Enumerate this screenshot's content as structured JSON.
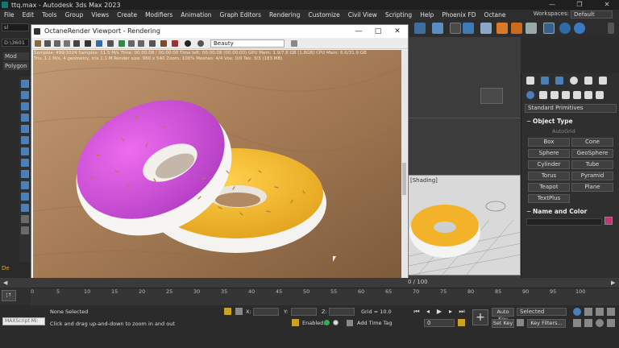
{
  "window": {
    "title": "ttq.max - Autodesk 3ds Max 2023",
    "minimize": "—",
    "maximize": "❐",
    "close": "✕"
  },
  "menu": {
    "items": [
      "File",
      "Edit",
      "Tools",
      "Group",
      "Views",
      "Create",
      "Modifiers",
      "Animation",
      "Graph Editors",
      "Rendering",
      "Customize",
      "Civil View",
      "Scripting",
      "Help",
      "Phoenix FD",
      "Octane"
    ],
    "workspaces_label": "Workspaces:",
    "workspaces_value": "Default"
  },
  "left_panel": {
    "field1": "sl",
    "field2": "D:\\3601",
    "tab1": "Mod",
    "tab2": "Polygon",
    "bottom_label": "De"
  },
  "octane": {
    "title": "OctaneRender Viewport - Rendering",
    "kernel": "Beauty",
    "stats_line1": "Samples: 499/1024   Samples: 11.5 M/s   Time: 00:00:08 / 00:00:00   Time left: 00:00:08 (00:00:00)   GPU Mem: 1.9/7.8 GB (1.8GB)   CPU Mem: 6.6/31.9 GB",
    "stats_line2": "Tris: 1.1 M/s, 4 geometry, tris 1.1 M   Render size: 960 x 540   Zoom: 100%   Meshes: 4/4   Vox: 0/0   Tex: 3/3 (183 MB)"
  },
  "small_viewport": {
    "label": "[Shading]"
  },
  "command_panel": {
    "dropdown": "Standard Primitives",
    "object_type_title": "Object Type",
    "autogrid": "AutoGrid",
    "buttons": [
      "Box",
      "Cone",
      "Sphere",
      "GeoSphere",
      "Cylinder",
      "Tube",
      "Torus",
      "Pyramid",
      "Teapot",
      "Plane",
      "TextPlus"
    ],
    "name_color_title": "Name and Color",
    "swatch_color": "#c8337a"
  },
  "timeline": {
    "frame_counter": "0 / 100",
    "ticks": [
      "0",
      "5",
      "10",
      "15",
      "20",
      "25",
      "30",
      "35",
      "40",
      "45",
      "50",
      "55",
      "60",
      "65",
      "70",
      "75",
      "80",
      "85",
      "90",
      "95",
      "100"
    ]
  },
  "statusbar": {
    "maxscript": "MAXScript Mi:",
    "selection": "None Selected",
    "prompt": "Click and drag up-and-down to zoom in and out",
    "x_label": "X:",
    "y_label": "Y:",
    "z_label": "Z:",
    "grid": "Grid = 10.0",
    "enabled": "Enabled:",
    "add_time_tag": "Add Time Tag",
    "frame_value": "0",
    "auto_key": "Auto Key",
    "set_key": "Set Key",
    "selected_dropdown": "Selected",
    "key_filters": "Key Filters..."
  },
  "colors": {
    "accent_blue": "#4b7fb5",
    "frosting_pink": "#d64fd6",
    "frosting_yellow": "#f2b32a"
  }
}
